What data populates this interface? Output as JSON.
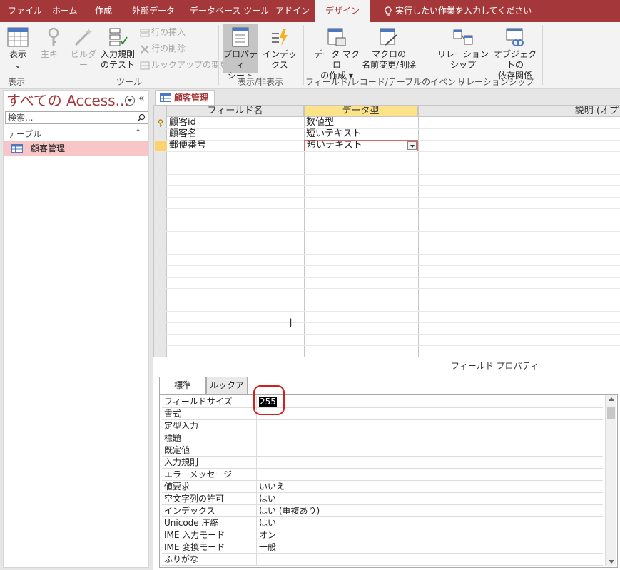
{
  "ribbon_tabs": [
    "ファイル",
    "ホーム",
    "作成",
    "外部データ",
    "データベース ツール",
    "アドイン",
    "デザイン"
  ],
  "active_tab": "デザイン",
  "tell_me": "実行したい作業を入力してください",
  "ribbon": {
    "view": "表示",
    "primary_key": "主キー",
    "builder": "ビルダー",
    "test_rules_line1": "入力規則",
    "test_rules_line2": "のテスト",
    "insert_rows": "行の挿入",
    "delete_rows": "行の削除",
    "modify_lookups": "ルックアップの変更",
    "property_sheet_line1": "プロパティ",
    "property_sheet_line2": "シート",
    "indexes": "インデックス",
    "create_macro_line1": "データ マクロ",
    "create_macro_line2": "の作成",
    "rename_macro_line1": "マクロの",
    "rename_macro_line2": "名前変更/削除",
    "relationships": "リレーションシップ",
    "obj_dep_line1": "オブジェクトの",
    "obj_dep_line2": "依存関係",
    "groups": {
      "views": "表示",
      "tools": "ツール",
      "show_hide": "表示/非表示",
      "events": "フィールド/レコード/テーブルのイベント",
      "relationships": "リレーションシップ"
    }
  },
  "nav": {
    "title": "すべての Access...",
    "search_placeholder": "検索...",
    "section": "テーブル",
    "items": [
      "顧客管理"
    ]
  },
  "object_tab": "顧客管理",
  "grid": {
    "headers": [
      "フィールド名",
      "データ型",
      "説明 (オプ"
    ],
    "rows": [
      {
        "field": "顧客id",
        "type": "数値型"
      },
      {
        "field": "顧客名",
        "type": "短いテキスト"
      },
      {
        "field": "郵便番号",
        "type": "短いテキスト"
      }
    ]
  },
  "field_properties": {
    "title": "フィールド プロパティ",
    "tabs": [
      "標準",
      "ルックアップ"
    ],
    "rows": [
      {
        "name": "フィールドサイズ",
        "value": "255"
      },
      {
        "name": "書式",
        "value": ""
      },
      {
        "name": "定型入力",
        "value": ""
      },
      {
        "name": "標題",
        "value": ""
      },
      {
        "name": "既定値",
        "value": ""
      },
      {
        "name": "入力規則",
        "value": ""
      },
      {
        "name": "エラーメッセージ",
        "value": ""
      },
      {
        "name": "値要求",
        "value": "いいえ"
      },
      {
        "name": "空文字列の許可",
        "value": "はい"
      },
      {
        "name": "インデックス",
        "value": "はい (重複あり)"
      },
      {
        "name": "Unicode 圧縮",
        "value": "はい"
      },
      {
        "name": "IME 入力モード",
        "value": "オン"
      },
      {
        "name": "IME 変換モード",
        "value": "一般"
      },
      {
        "name": "ふりがな",
        "value": ""
      }
    ]
  },
  "colors": {
    "brand": "#a4373a",
    "selected_header": "#fce38a",
    "nav_selected": "#f8c6c6",
    "annotation": "#d21f1f"
  }
}
